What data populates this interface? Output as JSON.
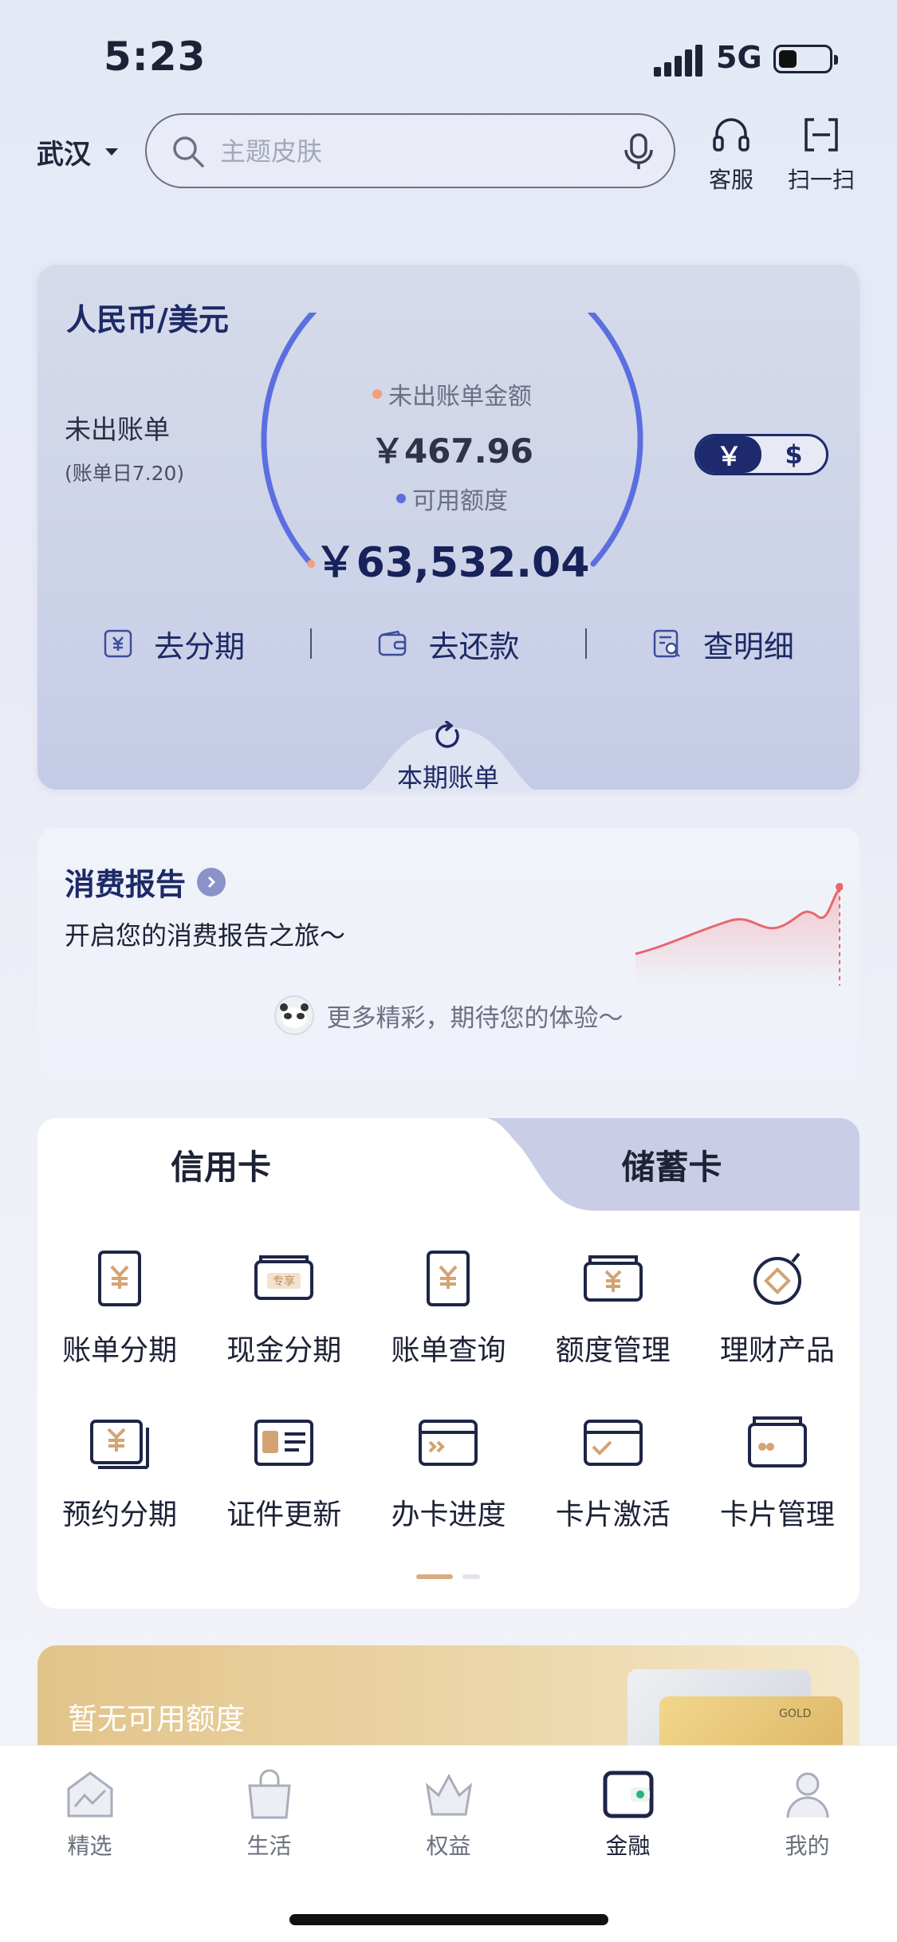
{
  "status_bar": {
    "time": "5:23",
    "network": "5G"
  },
  "header": {
    "city": "武汉",
    "search_placeholder": "主题皮肤",
    "actions": [
      {
        "label": "客服",
        "icon": "headset-icon"
      },
      {
        "label": "扫一扫",
        "icon": "scan-icon"
      }
    ]
  },
  "bill_card": {
    "currency_title": "人民币/美元",
    "unbilled_label": "未出账单",
    "bill_date": "(账单日7.20)",
    "unbilled_amount_label": "未出账单金额",
    "unbilled_amount": "￥467.96",
    "available_label": "可用额度",
    "available_amount": "￥63,532.04",
    "currency_options": [
      "￥",
      "$"
    ],
    "selected_currency": "￥",
    "actions": [
      {
        "label": "去分期",
        "icon": "installment-icon"
      },
      {
        "label": "去还款",
        "icon": "wallet-icon"
      },
      {
        "label": "查明细",
        "icon": "details-icon"
      }
    ],
    "current_bill_tab": "本期账单",
    "accent_blue": "#5b6fe0",
    "accent_orange": "#f0a07a"
  },
  "report": {
    "title": "消费报告",
    "subtitle": "开启您的消费报告之旅～",
    "more_text": "更多精彩，期待您的体验～",
    "trend_color": "#e8666f"
  },
  "menu": {
    "tabs": [
      "信用卡",
      "储蓄卡"
    ],
    "active_tab": "信用卡",
    "items": [
      {
        "label": "账单分期",
        "icon": "bill-installment-icon"
      },
      {
        "label": "现金分期",
        "icon": "cash-installment-icon"
      },
      {
        "label": "账单查询",
        "icon": "bill-query-icon"
      },
      {
        "label": "额度管理",
        "icon": "limit-management-icon"
      },
      {
        "label": "理财产品",
        "icon": "wealth-product-icon"
      },
      {
        "label": "预约分期",
        "icon": "reserve-installment-icon"
      },
      {
        "label": "证件更新",
        "icon": "id-update-icon"
      },
      {
        "label": "办卡进度",
        "icon": "card-progress-icon"
      },
      {
        "label": "卡片激活",
        "icon": "card-activate-icon"
      },
      {
        "label": "卡片管理",
        "icon": "card-management-icon"
      }
    ]
  },
  "promo": {
    "text": "暂无可用额度",
    "card_label": "GOLD"
  },
  "bottom_nav": {
    "items": [
      {
        "label": "精选",
        "icon": "featured-icon"
      },
      {
        "label": "生活",
        "icon": "life-bag-icon"
      },
      {
        "label": "权益",
        "icon": "crown-icon"
      },
      {
        "label": "金融",
        "icon": "finance-wallet-icon"
      },
      {
        "label": "我的",
        "icon": "profile-icon"
      }
    ],
    "active": "金融"
  }
}
